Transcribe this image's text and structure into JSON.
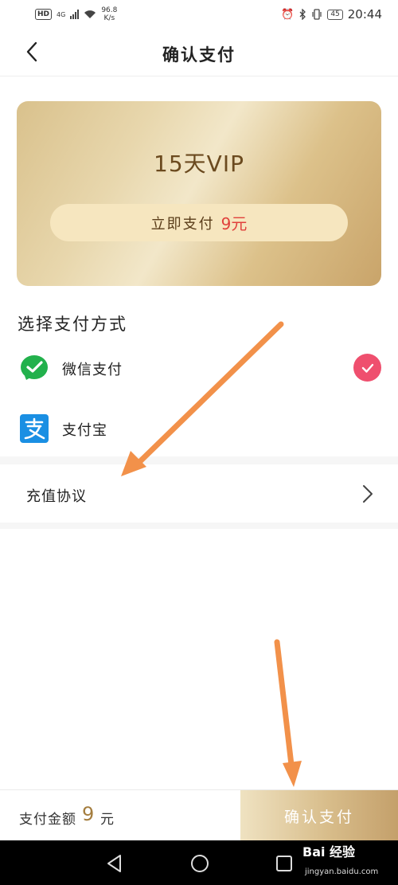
{
  "status_bar": {
    "network_badge": "HD",
    "network_type": "4G",
    "speed_value": "96.8",
    "speed_unit": "K/s",
    "battery": "45",
    "time": "20:44"
  },
  "header": {
    "title": "确认支付"
  },
  "vip_card": {
    "title": "15天VIP",
    "pay_now_label": "立即支付",
    "pay_now_price": "9元"
  },
  "payment": {
    "section_title": "选择支付方式",
    "methods": [
      {
        "label": "微信支付",
        "icon": "wechat-pay-icon",
        "selected": true
      },
      {
        "label": "支付宝",
        "icon": "alipay-icon",
        "selected": false
      }
    ]
  },
  "agreement": {
    "label": "充值协议"
  },
  "bottom_bar": {
    "amount_label": "支付金额",
    "amount_value": "9",
    "amount_unit": "元",
    "confirm_label": "确认支付"
  },
  "watermark": {
    "brand": "Bai 经验",
    "domain": "jingyan.baidu.com"
  },
  "colors": {
    "accent_red": "#e0413c",
    "check_pink": "#ef4f6e",
    "gold": "#a47d3e",
    "arrow_orange": "#f2914a"
  }
}
